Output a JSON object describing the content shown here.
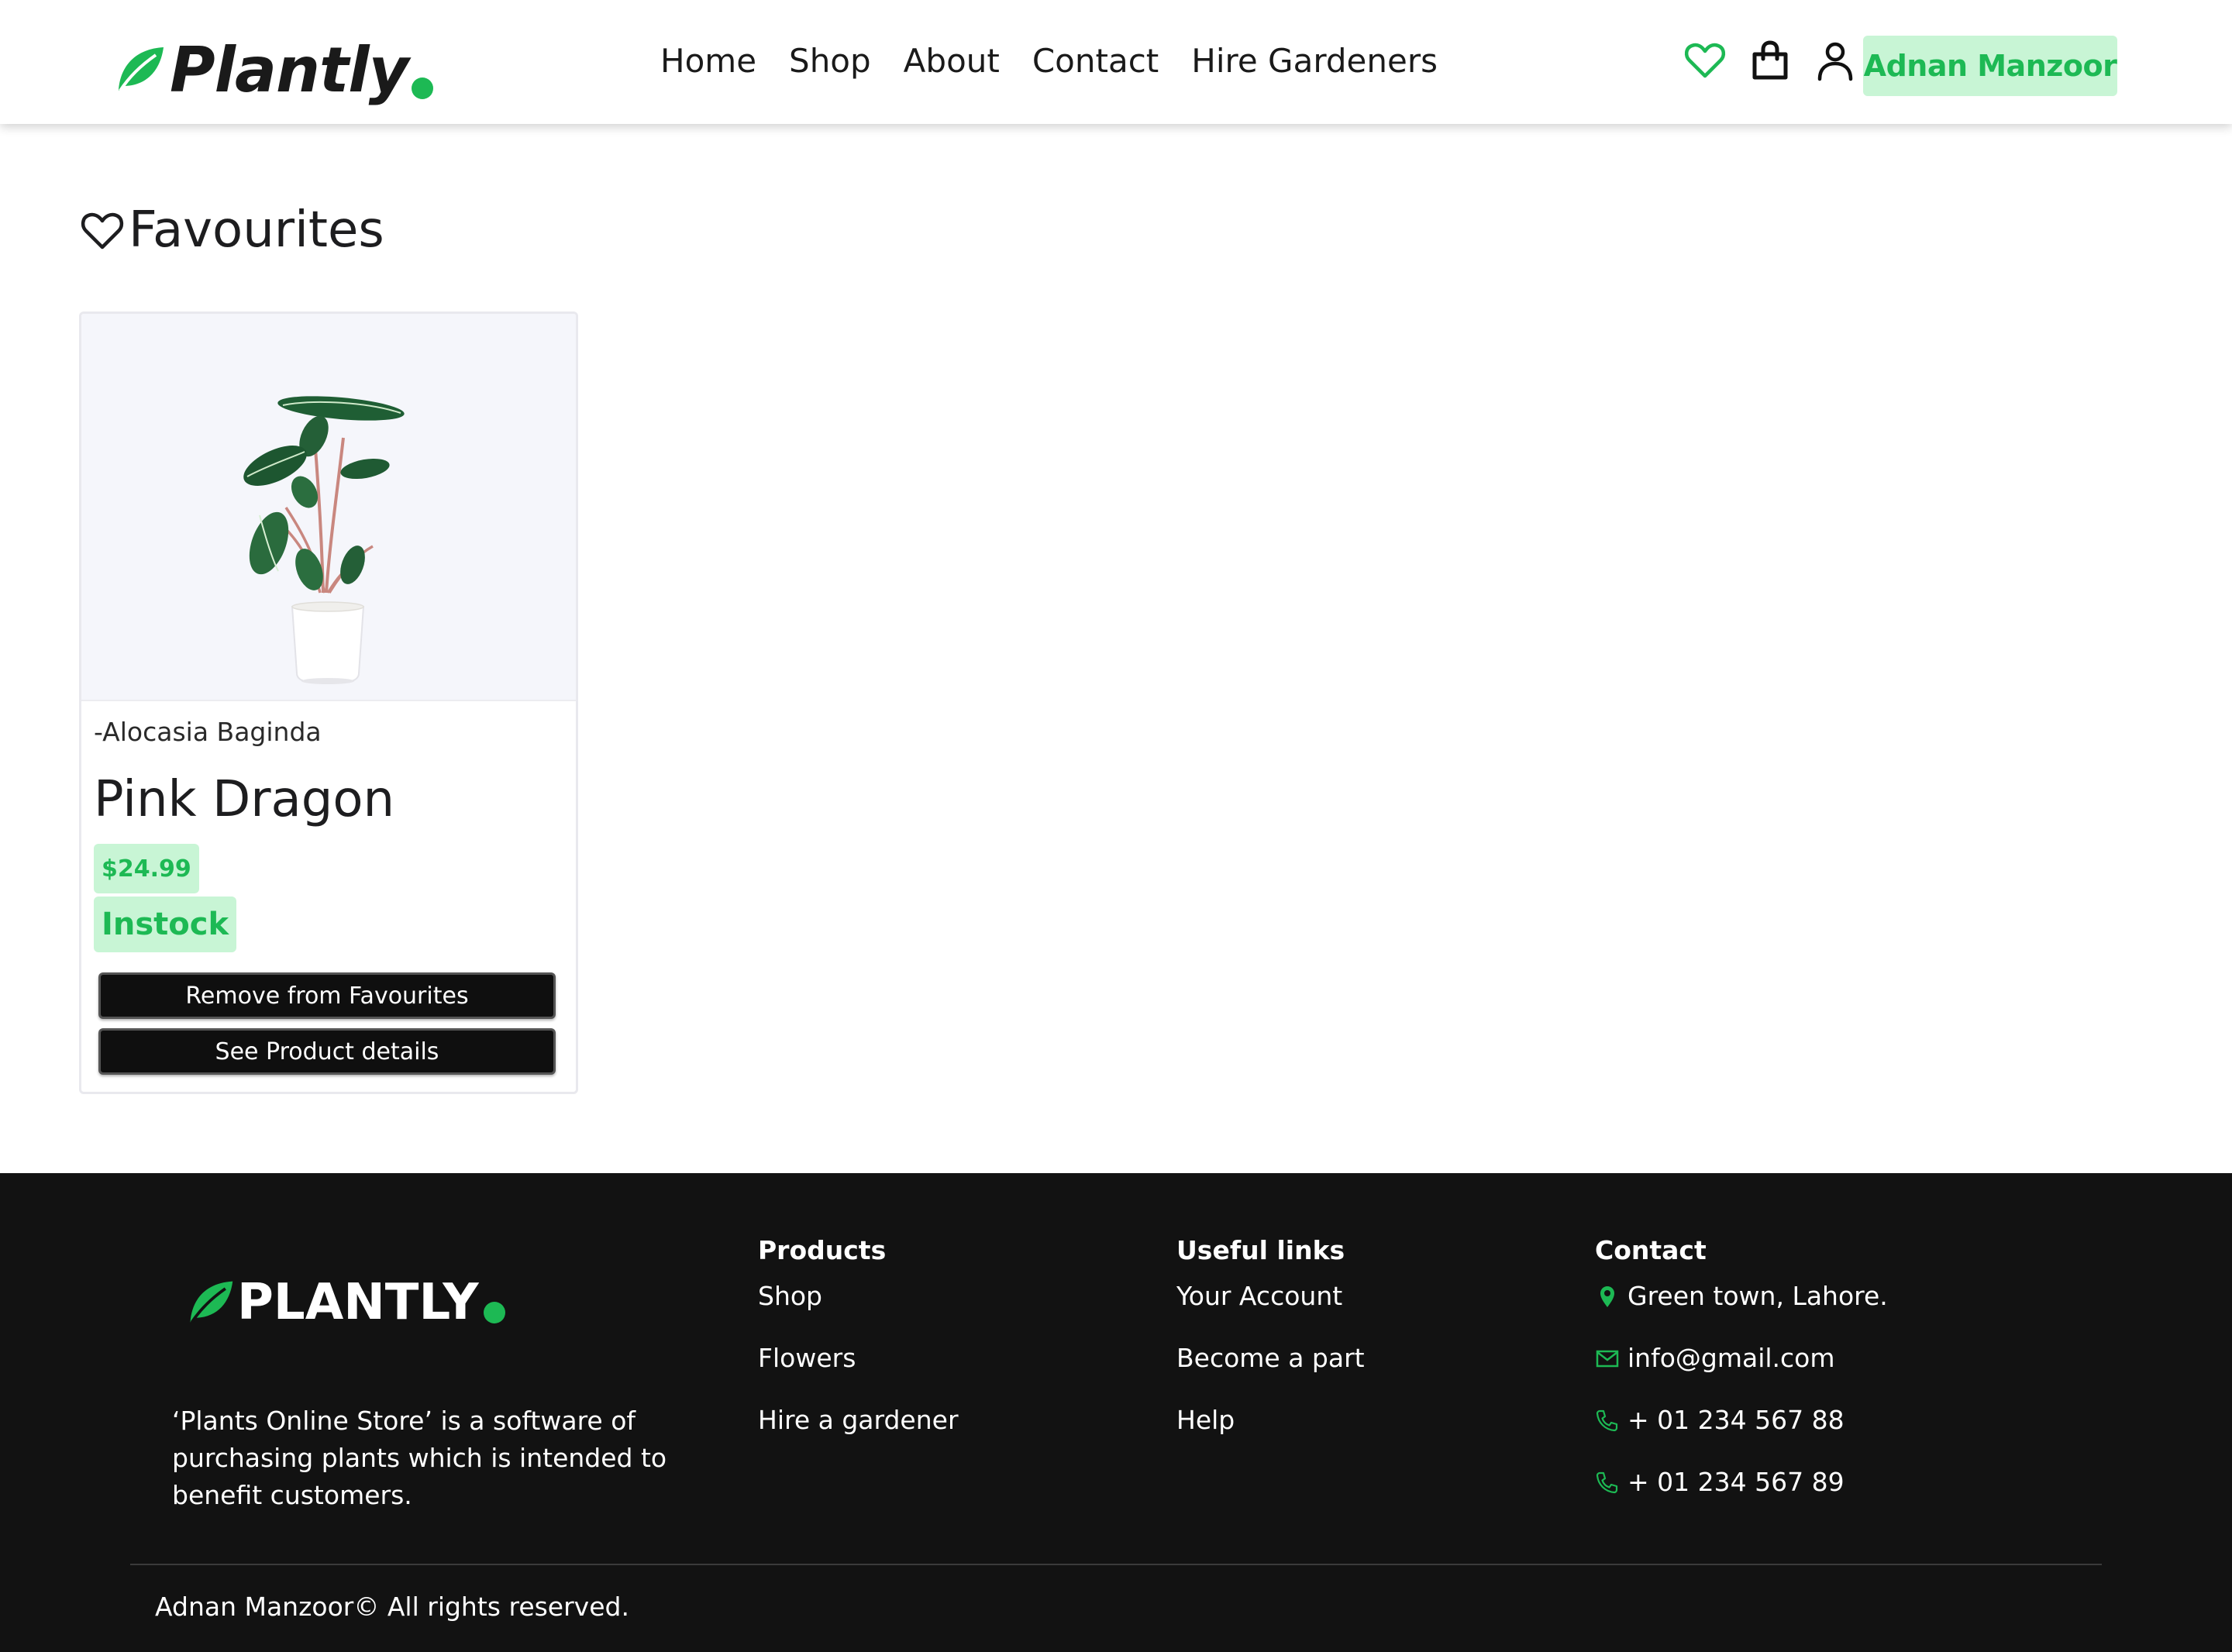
{
  "header": {
    "logo_text": "Plantly",
    "nav": [
      {
        "label": "Home"
      },
      {
        "label": "Shop"
      },
      {
        "label": "About"
      },
      {
        "label": "Contact"
      },
      {
        "label": "Hire Gardeners"
      }
    ],
    "icons": [
      "heart-icon",
      "shopping-bag-icon",
      "user-icon"
    ],
    "user_name": "Adnan Manzoor"
  },
  "main": {
    "heading": "Favourites",
    "favourites": [
      {
        "subtitle": "-Alocasia Baginda",
        "name": "Pink Dragon",
        "price": "$24.99",
        "stock": "Instock",
        "remove_label": "Remove from Favourites",
        "details_label": "See Product details"
      }
    ]
  },
  "footer": {
    "logo_text": "PLANTLY",
    "description": "‘Plants Online Store’ is a software of purchasing plants which is intended to benefit customers.",
    "columns": {
      "products": {
        "title": "Products",
        "items": [
          "Shop",
          "Flowers",
          "Hire a gardener"
        ]
      },
      "useful": {
        "title": "Useful links",
        "items": [
          "Your Account",
          "Become a part",
          "Help"
        ]
      },
      "contact": {
        "title": "Contact",
        "items": [
          {
            "icon": "location-pin-icon",
            "text": "Green town, Lahore."
          },
          {
            "icon": "mail-icon",
            "text": "info@gmail.com"
          },
          {
            "icon": "phone-icon",
            "text": "+ 01 234 567 88"
          },
          {
            "icon": "phone-icon",
            "text": "+ 01 234 567 89"
          }
        ]
      }
    },
    "copyright": "Adnan Manzoor© All rights reserved."
  },
  "colors": {
    "accent": "#1db954",
    "accent_light": "#c8f5d5",
    "footer_bg": "#121212",
    "button_bg": "#0f0f0f"
  }
}
